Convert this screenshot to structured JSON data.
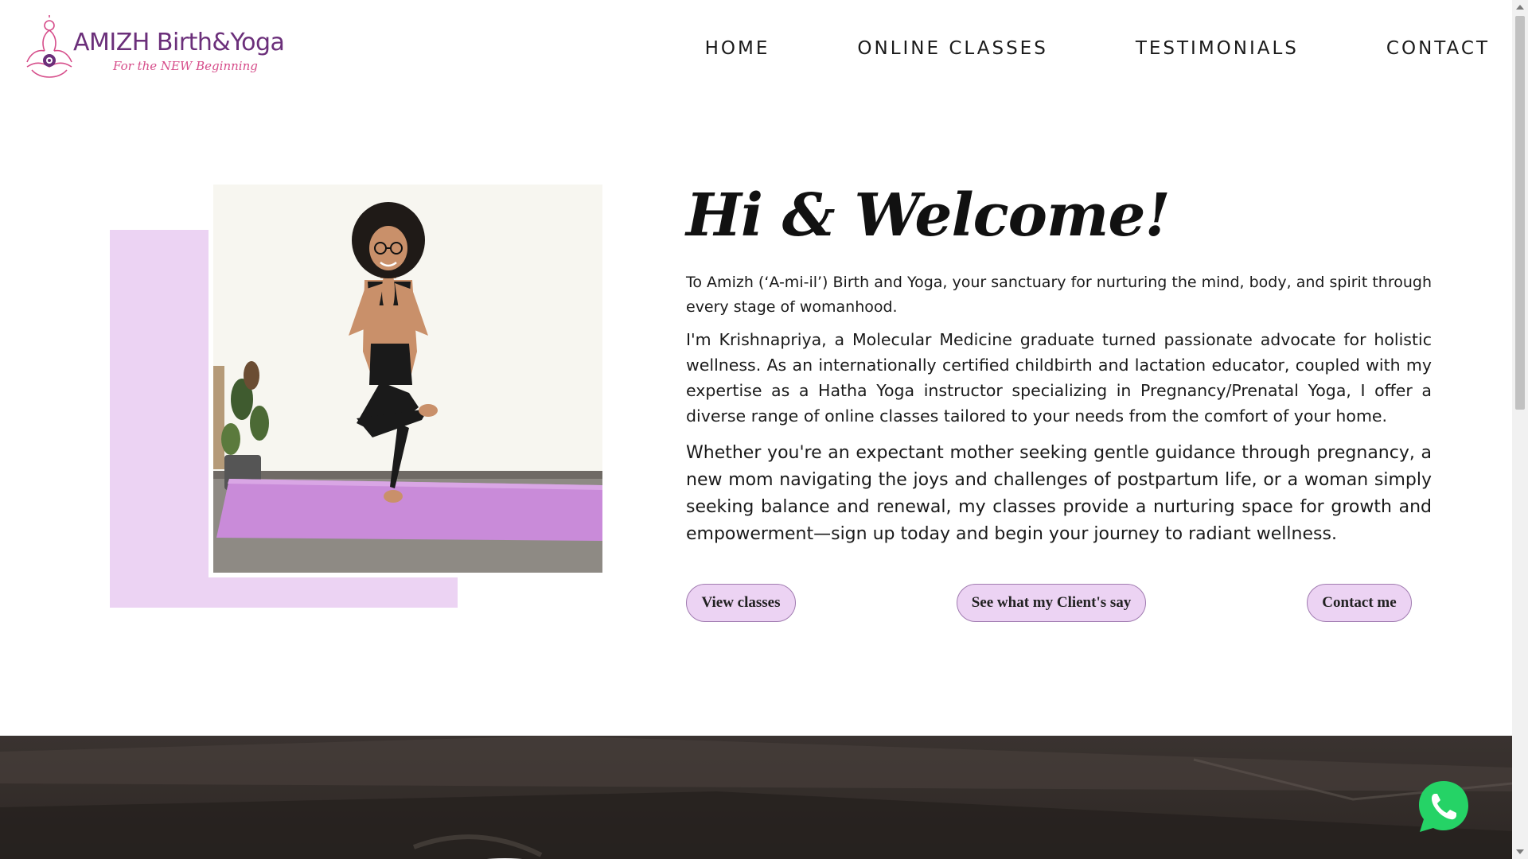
{
  "brand": {
    "title": "AMIZH Birth&Yoga",
    "tagline": "For the NEW Beginning",
    "primary_color": "#6b2f7a",
    "accent_color": "#d64d8a",
    "highlight_color": "#ecd3f3"
  },
  "nav": {
    "items": [
      {
        "label": "HOME"
      },
      {
        "label": "ONLINE CLASSES"
      },
      {
        "label": "TESTIMONIALS"
      },
      {
        "label": "CONTACT"
      }
    ]
  },
  "hero": {
    "title": "Hi & Welcome!",
    "paragraphs": [
      "To Amizh (‘A-mi-il’) Birth and Yoga, your sanctuary for nurturing the mind, body, and spirit through every stage of womanhood.",
      "I'm Krishnapriya, a Molecular Medicine graduate turned passionate advocate for holistic wellness. As an internationally certified childbirth and lactation educator, coupled with my expertise as a Hatha Yoga instructor specializing in Pregnancy/Prenatal Yoga, I offer a diverse range of online classes tailored to your needs from the comfort of your home.",
      "Whether you're an expectant mother seeking gentle guidance through pregnancy, a new mom navigating the joys and challenges of postpartum life, or a woman simply seeking balance and renewal, my classes provide a nurturing space for growth and empowerment—sign up today and begin your journey to radiant wellness."
    ],
    "buttons": {
      "view_classes": "View classes",
      "client_say": "See what my Client's say",
      "contact_me": "Contact me"
    }
  },
  "icons": {
    "logo": "meditation-lotus-icon",
    "whatsapp": "whatsapp-icon",
    "whatsapp_color": "#25d366"
  }
}
